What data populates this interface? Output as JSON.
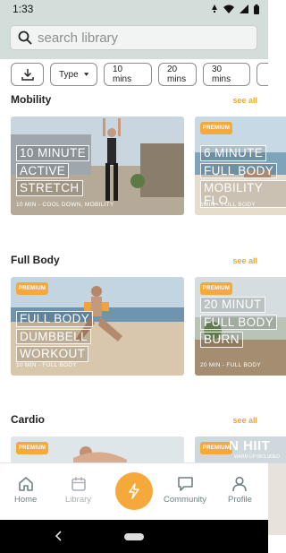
{
  "status": {
    "time": "1:33"
  },
  "search": {
    "placeholder": "search library"
  },
  "filters": {
    "type_label": "Type",
    "durations": [
      "10 mins",
      "20 mins",
      "30 mins"
    ]
  },
  "sections": [
    {
      "title": "Mobility",
      "see_all": "see all",
      "cards": [
        {
          "title_lines": [
            "10 MINUTE",
            "ACTIVE",
            "STRETCH"
          ],
          "meta": "10 MIN - COOL DOWN, MOBILITY",
          "badge": ""
        },
        {
          "title_lines": [
            "6 MINUTE",
            "FULL BODY",
            "MOBILITY FLO"
          ],
          "meta": "6MIN - FULL BODY",
          "badge": "PREMIUM"
        }
      ]
    },
    {
      "title": "Full Body",
      "see_all": "see all",
      "cards": [
        {
          "title_lines": [
            "FULL BODY",
            "DUMBBELL",
            "WORKOUT"
          ],
          "meta": "10 MIN - FULL BODY",
          "badge": "PREMIUM"
        },
        {
          "title_lines": [
            "20 MINUT",
            "FULL BODY",
            "BURN"
          ],
          "meta": "20 MIN - FULL BODY",
          "badge": "PREMIUM"
        }
      ]
    },
    {
      "title": "Cardio",
      "see_all": "see all",
      "cards": [
        {
          "badge": "PREMIUM"
        },
        {
          "badge": "PREMIUM",
          "title_fragment": "N HIIT",
          "subtitle_fragment": "WARM UP INCLUDED"
        }
      ]
    }
  ],
  "nav": {
    "home": "Home",
    "library": "Library",
    "community": "Community",
    "profile": "Profile"
  },
  "colors": {
    "accent": "#f5a93a",
    "header_bg": "#d3ddd9",
    "see_all": "#e8a733"
  },
  "icons": [
    "search-icon",
    "download-icon",
    "caret-down-icon",
    "home-icon",
    "calendar-icon",
    "lightning-icon",
    "chat-icon",
    "person-icon",
    "wifi-icon",
    "signal-icon",
    "battery-icon",
    "back-icon"
  ]
}
